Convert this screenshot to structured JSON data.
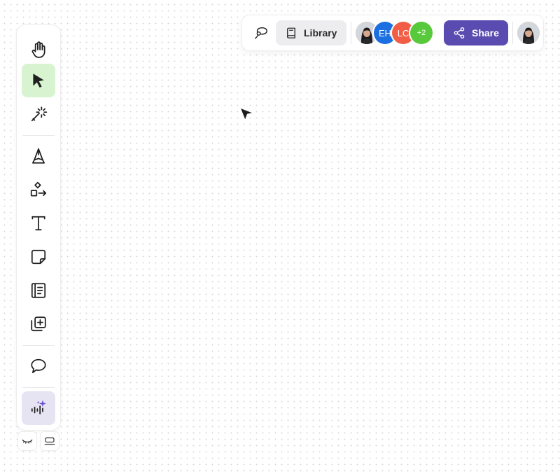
{
  "toolbar": {
    "tools": [
      {
        "name": "hand",
        "icon": "hand-icon"
      },
      {
        "name": "selection",
        "icon": "pointer-arrow-icon",
        "active": true
      },
      {
        "name": "laser",
        "icon": "magic-wand-icon"
      },
      {
        "name": "pen",
        "icon": "pen-nib-icon"
      },
      {
        "name": "shapes",
        "icon": "shapes-arrow-icon"
      },
      {
        "name": "text",
        "icon": "text-t-icon"
      },
      {
        "name": "sticky-note",
        "icon": "sticky-note-icon"
      },
      {
        "name": "frame",
        "icon": "document-frame-icon"
      },
      {
        "name": "embed",
        "icon": "add-layer-icon"
      },
      {
        "name": "comment",
        "icon": "speech-bubble-icon"
      },
      {
        "name": "ai-assistant",
        "icon": "sparkle-voice-icon"
      }
    ],
    "mini_buttons": [
      {
        "name": "hide-ui",
        "icon": "closed-eye-icon"
      },
      {
        "name": "minimize",
        "icon": "minimize-panel-icon"
      }
    ]
  },
  "topbar": {
    "lasso_icon": "lasso-icon",
    "library_label": "Library",
    "library_icon": "book-icon",
    "collaborators": [
      {
        "type": "photo",
        "name": "user-avatar-photo"
      },
      {
        "initials": "EH",
        "color": "#1b6fe0"
      },
      {
        "initials": "LC",
        "color": "#f15d45"
      },
      {
        "more": "+2",
        "color": "#57c93a"
      }
    ],
    "share_label": "Share",
    "share_icon": "share-nodes-icon",
    "share_color": "#5a4bb0"
  },
  "colors": {
    "active_tool_bg": "#d8f3cf",
    "ai_tool_bg": "#e6e3f2",
    "accent": "#5a4bb0"
  }
}
